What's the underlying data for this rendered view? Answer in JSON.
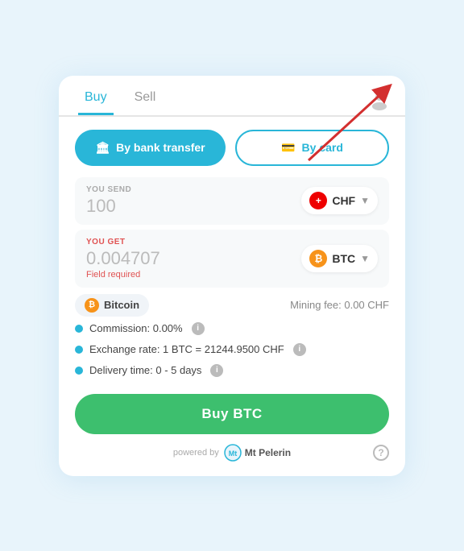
{
  "tabs": {
    "buy_label": "Buy",
    "sell_label": "Sell",
    "active": "buy"
  },
  "payment": {
    "bank_label": "By bank transfer",
    "card_label": "By card"
  },
  "send": {
    "label": "YOU SEND",
    "value": "100",
    "currency": "CHF",
    "currency_symbol": "+"
  },
  "get": {
    "label": "YOU GET",
    "value": "0.004707",
    "field_required": "Field required",
    "currency": "BTC"
  },
  "crypto": {
    "name": "Bitcoin",
    "mining_fee": "Mining fee: 0.00 CHF"
  },
  "details": {
    "commission": "Commission: 0.00%",
    "exchange_rate": "Exchange rate: 1 BTC = 21244.9500 CHF",
    "delivery_time": "Delivery time: 0 - 5 days"
  },
  "buy_button": "Buy BTC",
  "footer": {
    "powered_by": "powered by",
    "brand": "Mt\nPelerin"
  },
  "help": "?",
  "icons": {
    "bank": "🏛",
    "card": "💳",
    "user": "👤",
    "info": "i",
    "bitcoin": "₿",
    "chf": "+",
    "btc": "₿"
  }
}
